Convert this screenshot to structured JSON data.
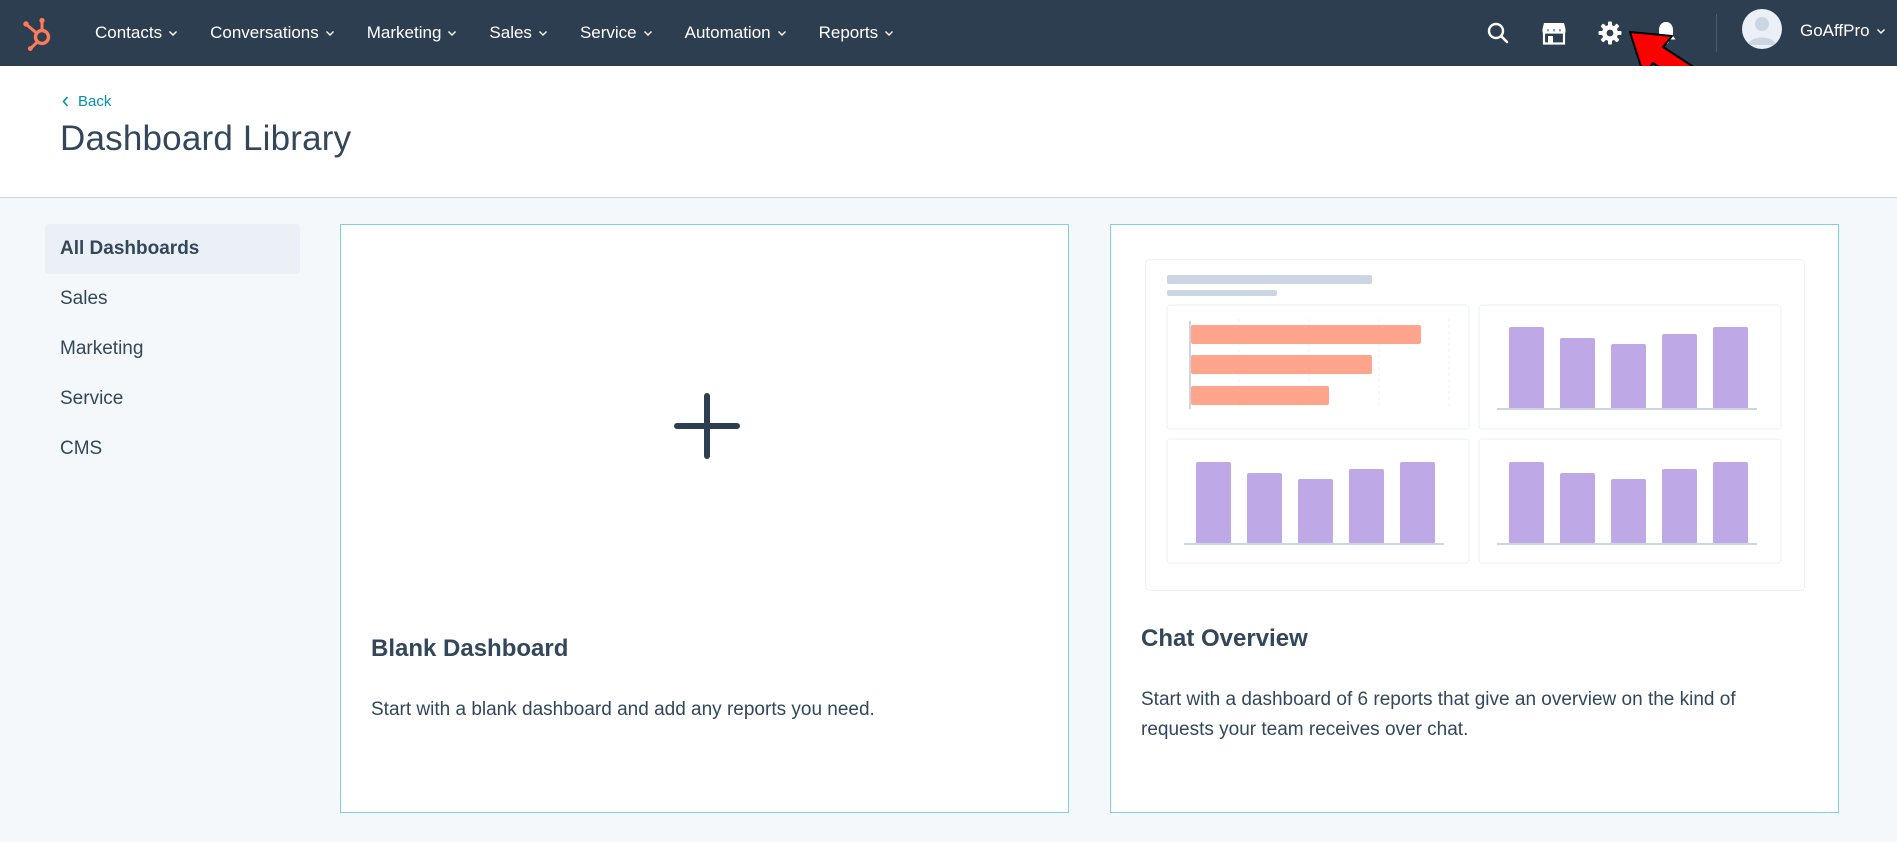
{
  "nav": {
    "items": [
      {
        "label": "Contacts"
      },
      {
        "label": "Conversations"
      },
      {
        "label": "Marketing"
      },
      {
        "label": "Sales"
      },
      {
        "label": "Service"
      },
      {
        "label": "Automation"
      },
      {
        "label": "Reports"
      }
    ],
    "account_name": "GoAffPro",
    "icons": [
      "search-icon",
      "marketplace-icon",
      "settings-gear-icon",
      "notifications-bell-icon"
    ]
  },
  "header": {
    "back_label": "Back",
    "title": "Dashboard Library"
  },
  "sidebar": {
    "items": [
      {
        "label": "All Dashboards",
        "active": true
      },
      {
        "label": "Sales"
      },
      {
        "label": "Marketing"
      },
      {
        "label": "Service"
      },
      {
        "label": "CMS"
      }
    ]
  },
  "cards": [
    {
      "title": "Blank Dashboard",
      "description": "Start with a blank dashboard and add any reports you need."
    },
    {
      "title": "Chat Overview",
      "description": "Start with a dashboard of 6 reports that give an overview on the kind of requests your team receives over chat."
    }
  ],
  "colors": {
    "nav_bg": "#2d3e50",
    "accent_link": "#0091ae",
    "card_border": "#7fd1de",
    "brand_orange": "#ff7a59",
    "bar_salmon": "#ffa58c",
    "bar_purple": "#bea8e6",
    "annotation_red": "#ff0000"
  }
}
